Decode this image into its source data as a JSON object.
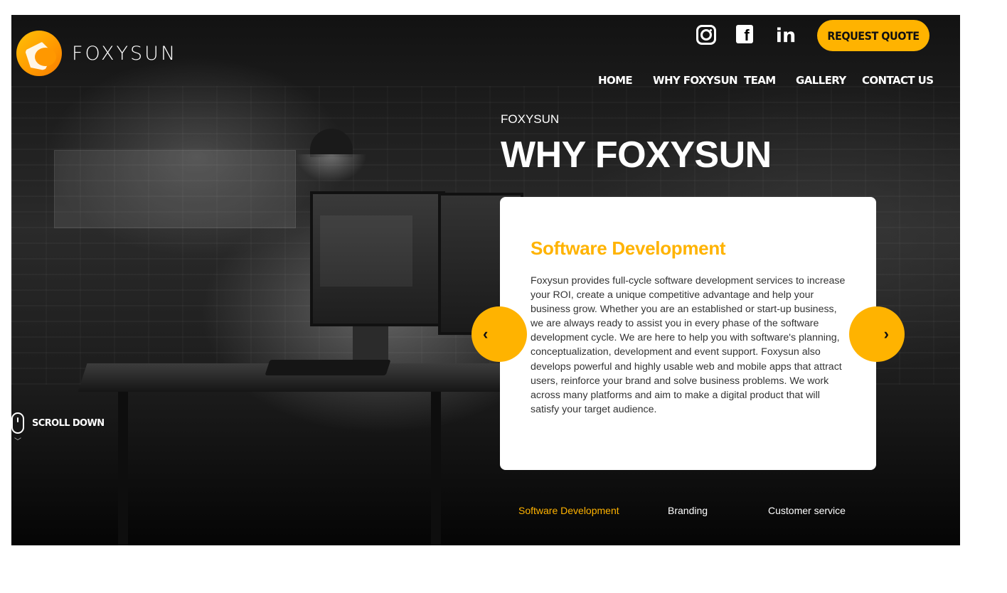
{
  "header": {
    "brand": "FOXYSUN",
    "social_icons": [
      "instagram-icon",
      "facebook-icon",
      "linkedin-icon"
    ],
    "linkedin_glyph": "in",
    "facebook_glyph": "f",
    "quote_button": "REQUEST QUOTE",
    "nav": [
      "HOME",
      "WHY FOXYSUN",
      "TEAM",
      "GALLERY",
      "CONTACT US"
    ]
  },
  "hero": {
    "eyebrow": "FOXYSUN",
    "title": "WHY FOXYSUN",
    "scroll_label": "SCROLL DOWN"
  },
  "slide": {
    "title": "Software Development",
    "body": "Foxysun provides full-cycle software development services to increase your ROI, create a unique competitive advantage and help your business grow. Whether you are an established or start-up business, we are always ready to assist you in every phase of the software development cycle. We are here to help you with software's planning, conceptualization, development and event support. Foxysun also develops powerful and highly usable web and mobile apps that attract users, reinforce your brand and solve business problems. We work across many platforms and aim to make a digital product that will satisfy your target audience.",
    "prev_icon": "chevron-left-icon",
    "next_icon": "chevron-right-icon"
  },
  "tabs": [
    {
      "label": "Software Development",
      "active": true
    },
    {
      "label": "Branding",
      "active": false
    },
    {
      "label": "Customer service",
      "active": false
    }
  ],
  "colors": {
    "accent": "#ffb300",
    "background": "#000000",
    "card": "#ffffff"
  }
}
